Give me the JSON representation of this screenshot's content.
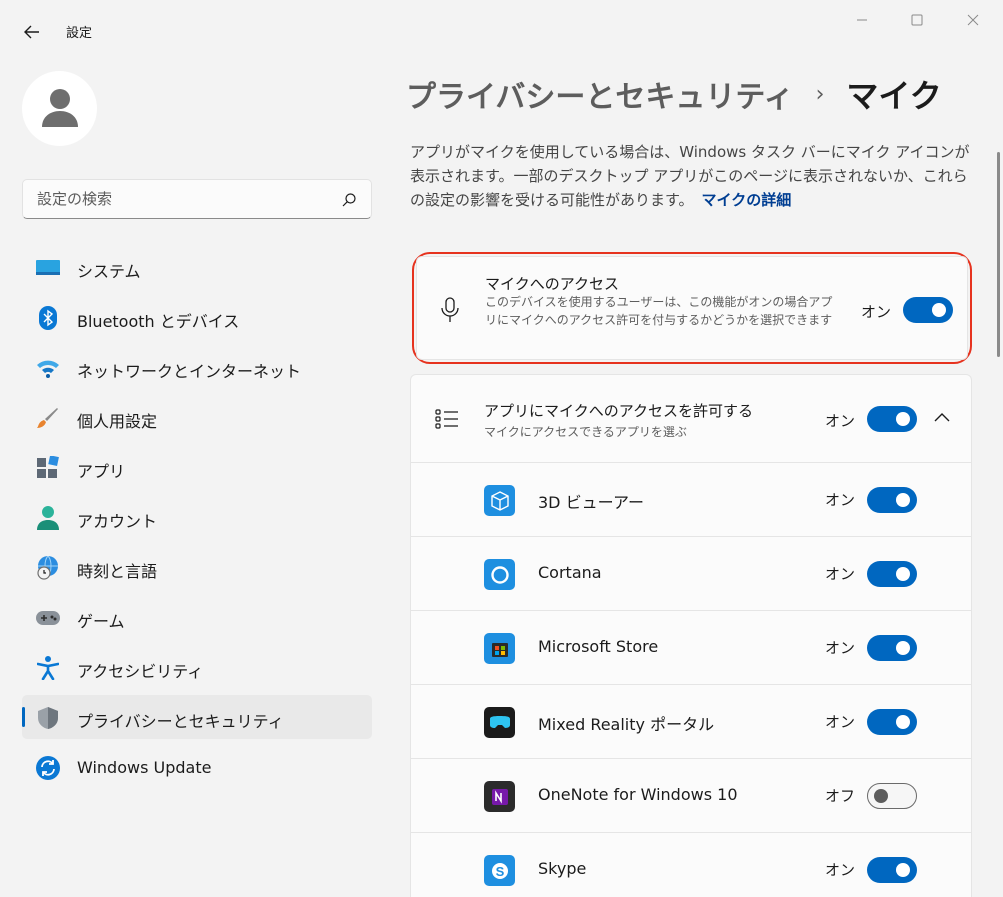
{
  "window": {
    "title": "設定"
  },
  "user": {
    "avatar_icon": "person-icon"
  },
  "search": {
    "placeholder": "設定の検索"
  },
  "nav": {
    "items": [
      {
        "label": "システム",
        "icon": "system-icon"
      },
      {
        "label": "Bluetooth とデバイス",
        "icon": "bluetooth-icon"
      },
      {
        "label": "ネットワークとインターネット",
        "icon": "wifi-icon"
      },
      {
        "label": "個人用設定",
        "icon": "brush-icon"
      },
      {
        "label": "アプリ",
        "icon": "apps-icon"
      },
      {
        "label": "アカウント",
        "icon": "account-icon"
      },
      {
        "label": "時刻と言語",
        "icon": "time-language-icon"
      },
      {
        "label": "ゲーム",
        "icon": "gamepad-icon"
      },
      {
        "label": "アクセシビリティ",
        "icon": "accessibility-icon"
      },
      {
        "label": "プライバシーとセキュリティ",
        "icon": "shield-icon",
        "active": true
      },
      {
        "label": "Windows Update",
        "icon": "update-icon"
      }
    ]
  },
  "breadcrumb": {
    "parent": "プライバシーとセキュリティ",
    "separator": "›",
    "current": "マイク"
  },
  "description": {
    "text": "アプリがマイクを使用している場合は、Windows タスク バーにマイク アイコンが表示されます。一部のデスクトップ アプリがこのページに表示されないか、これらの設定の影響を受ける可能性があります。",
    "link": "マイクの詳細"
  },
  "mic_access": {
    "title": "マイクへのアクセス",
    "description": "このデバイスを使用するユーザーは、この機能がオンの場合アプリにマイクへのアクセス許可を付与するかどうかを選択できます",
    "state_label": "オン",
    "on": true
  },
  "apps_access": {
    "title": "アプリにマイクへのアクセスを許可する",
    "description": "マイクにアクセスできるアプリを選ぶ",
    "state_label": "オン",
    "on": true
  },
  "apps": [
    {
      "name": "3D ビューアー",
      "state_label": "オン",
      "on": true,
      "icon": "3d-viewer-icon"
    },
    {
      "name": "Cortana",
      "state_label": "オン",
      "on": true,
      "icon": "cortana-icon"
    },
    {
      "name": "Microsoft Store",
      "state_label": "オン",
      "on": true,
      "icon": "store-icon"
    },
    {
      "name": "Mixed Reality ポータル",
      "state_label": "オン",
      "on": true,
      "icon": "mixed-reality-icon"
    },
    {
      "name": "OneNote for Windows 10",
      "state_label": "オフ",
      "on": false,
      "icon": "onenote-icon"
    },
    {
      "name": "Skype",
      "state_label": "オン",
      "on": true,
      "icon": "skype-icon"
    }
  ],
  "colors": {
    "accent": "#0067c0",
    "highlight": "#e6321e"
  }
}
